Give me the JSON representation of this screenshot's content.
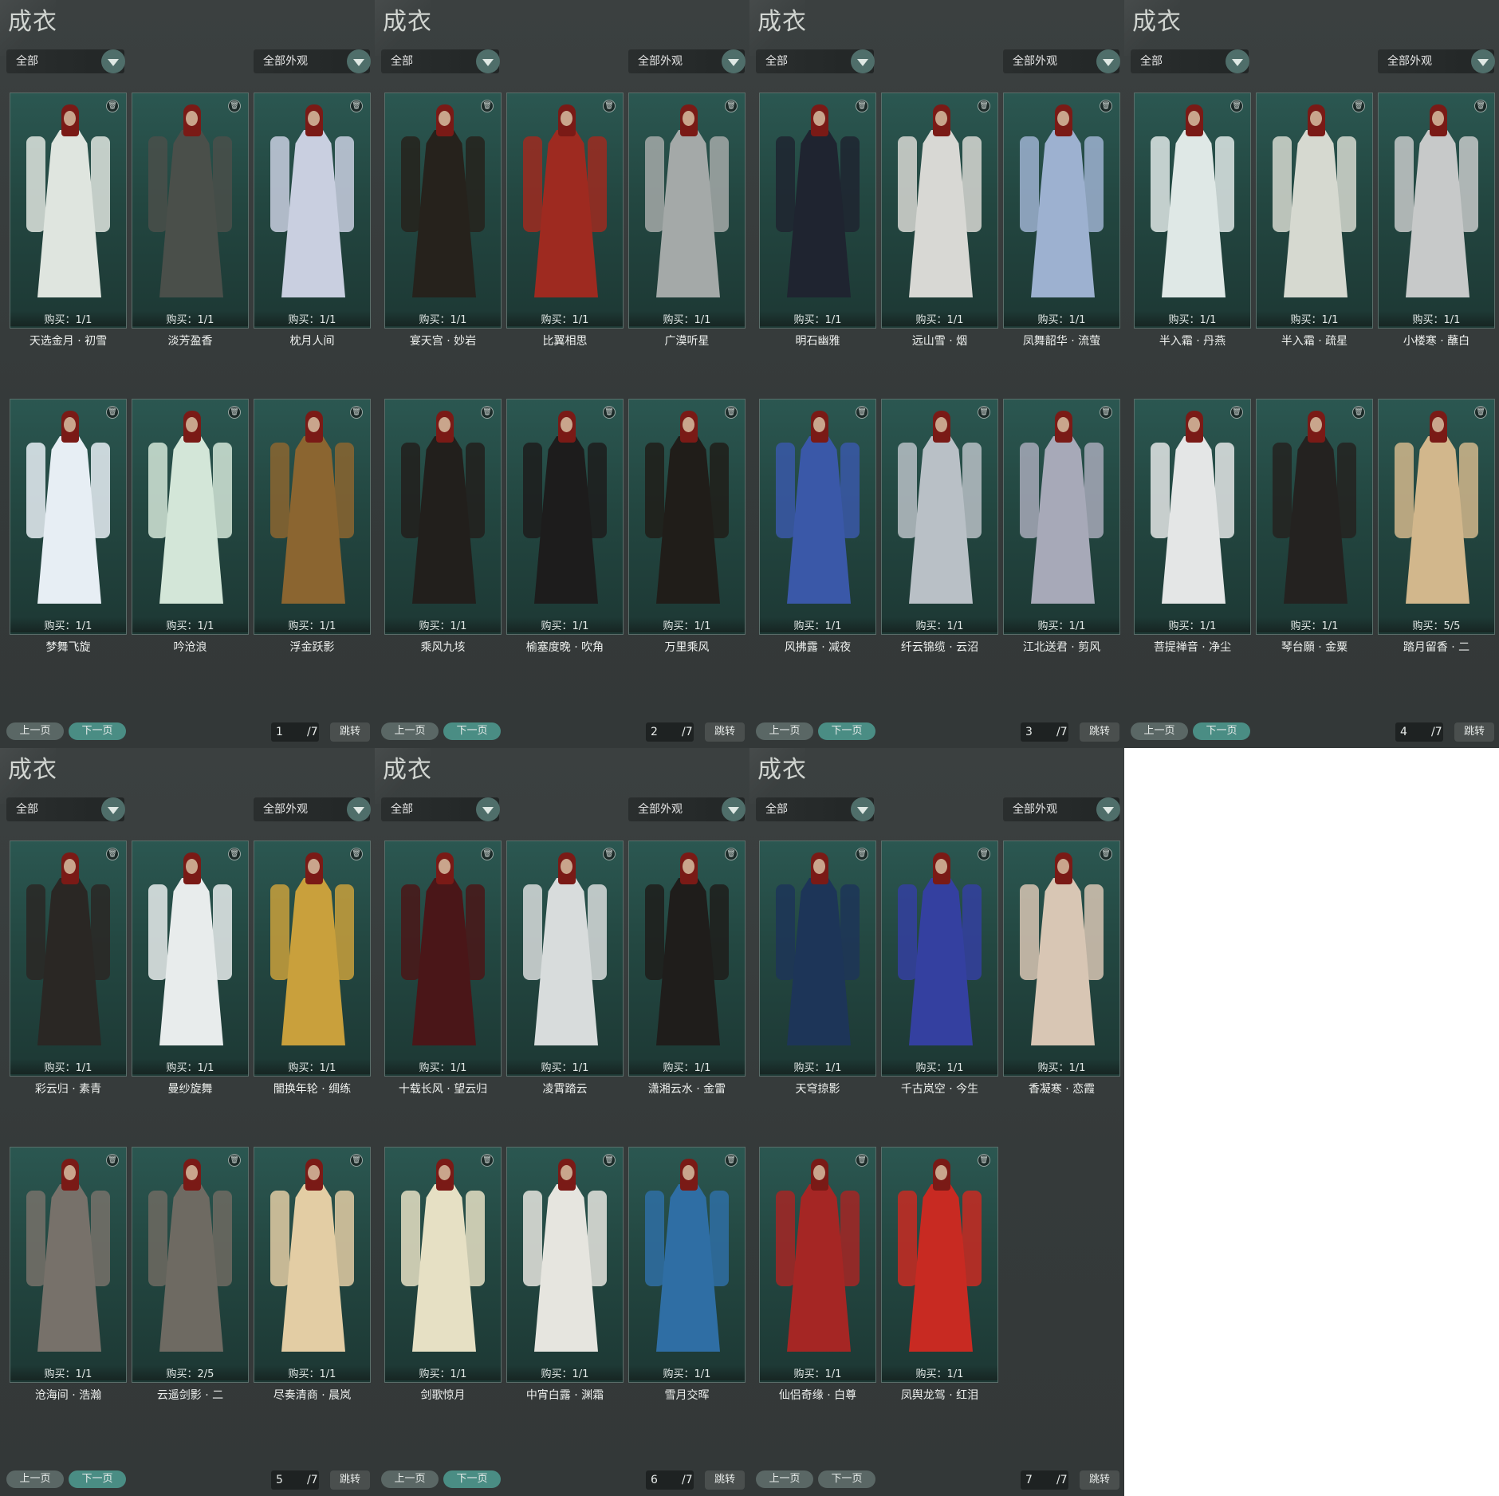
{
  "title": "成衣",
  "filter_left": "全部",
  "filter_right": "全部外观",
  "prev_label": "上一页",
  "next_label": "下一页",
  "jump_label": "跳转",
  "page_total": "/7",
  "trash_icon": "trash-icon",
  "panels": [
    {
      "page": "1",
      "items": [
        {
          "buy": "购买：1/1",
          "name": "天选金月 · 初雪",
          "color": "#dfe5df"
        },
        {
          "buy": "购买：1/1",
          "name": "淡芳盈香",
          "color": "#4a4f4a"
        },
        {
          "buy": "购买：1/1",
          "name": "枕月人间",
          "color": "#c9cfe0"
        },
        {
          "buy": "购买：1/1",
          "name": "梦舞飞旋",
          "color": "#e7eef4"
        },
        {
          "buy": "购买：1/1",
          "name": "吟沧浪",
          "color": "#d3e6d8"
        },
        {
          "buy": "购买：1/1",
          "name": "浮金跃影",
          "color": "#8b6530"
        }
      ]
    },
    {
      "page": "2",
      "items": [
        {
          "buy": "购买：1/1",
          "name": "宴天宫 · 妙岩",
          "color": "#26221c"
        },
        {
          "buy": "购买：1/1",
          "name": "比翼相思",
          "color": "#9e2a20"
        },
        {
          "buy": "购买：1/1",
          "name": "广漠听星",
          "color": "#a4a9a8"
        },
        {
          "buy": "购买：1/1",
          "name": "乘风九垓",
          "color": "#221f1c"
        },
        {
          "buy": "购买：1/1",
          "name": "榆塞度晚 · 吹角",
          "color": "#1d1c1c"
        },
        {
          "buy": "购买：1/1",
          "name": "万里乘风",
          "color": "#201d19"
        }
      ]
    },
    {
      "page": "3",
      "items": [
        {
          "buy": "购买：1/1",
          "name": "明石幽雅",
          "color": "#1f2430"
        },
        {
          "buy": "购买：1/1",
          "name": "远山雪 · 烟",
          "color": "#d8d8d4"
        },
        {
          "buy": "购买：1/1",
          "name": "凤舞韶华 · 流萤",
          "color": "#9db1d0"
        },
        {
          "buy": "购买：1/1",
          "name": "风拂露 · 减夜",
          "color": "#3a58a8"
        },
        {
          "buy": "购买：1/1",
          "name": "纤云锦缆 · 云沼",
          "color": "#b9c0c6"
        },
        {
          "buy": "购买：1/1",
          "name": "江北送君 · 剪风",
          "color": "#a7a9b8"
        }
      ]
    },
    {
      "page": "4",
      "items": [
        {
          "buy": "购买：1/1",
          "name": "半入霜 · 丹燕",
          "color": "#dfe8e6"
        },
        {
          "buy": "购买：1/1",
          "name": "半入霜 · 疏星",
          "color": "#d6d9d0"
        },
        {
          "buy": "购买：1/1",
          "name": "小楼寒 · 蘸白",
          "color": "#c7c9c9"
        },
        {
          "buy": "购买：1/1",
          "name": "菩提禅音 · 净尘",
          "color": "#e4e6e6"
        },
        {
          "buy": "购买：1/1",
          "name": "琴台願 · 金粟",
          "color": "#242220"
        },
        {
          "buy": "购买：5/5",
          "name": "踏月留香 · 二",
          "color": "#d2b78c"
        }
      ]
    },
    {
      "page": "5",
      "items": [
        {
          "buy": "购买：1/1",
          "name": "彩云归 · 素青",
          "color": "#2a2724"
        },
        {
          "buy": "购买：1/1",
          "name": "曼纱旋舞",
          "color": "#e8ecec"
        },
        {
          "buy": "购买：1/1",
          "name": "闇换年轮 · 绸练",
          "color": "#c9a03c"
        },
        {
          "buy": "购买：1/1",
          "name": "沧海间 · 浩瀚",
          "color": "#77716a"
        },
        {
          "buy": "购买：2/5",
          "name": "云遥剑影 · 二",
          "color": "#6e6a62"
        },
        {
          "buy": "购买：1/1",
          "name": "尽奏清商 · 晨岚",
          "color": "#e3cda4"
        }
      ]
    },
    {
      "page": "6",
      "items": [
        {
          "buy": "购买：1/1",
          "name": "十载长风 · 望云归",
          "color": "#4a1618"
        },
        {
          "buy": "购买：1/1",
          "name": "凌霄踏云",
          "color": "#d8dcdc"
        },
        {
          "buy": "购买：1/1",
          "name": "潇湘云水 · 金雷",
          "color": "#1f1d1b"
        },
        {
          "buy": "购买：1/1",
          "name": "剑歌惊月",
          "color": "#e6e0c4"
        },
        {
          "buy": "购买：1/1",
          "name": "中宵白露 · 渊霜",
          "color": "#e6e5df"
        },
        {
          "buy": "购买：1/1",
          "name": "雪月交晖",
          "color": "#2f6ea4"
        }
      ]
    },
    {
      "page": "7",
      "items": [
        {
          "buy": "购买：1/1",
          "name": "天穹掠影",
          "color": "#1d3558"
        },
        {
          "buy": "购买：1/1",
          "name": "千古岚空 · 今生",
          "color": "#3440a0"
        },
        {
          "buy": "购买：1/1",
          "name": "香凝寒 · 恋霞",
          "color": "#d8c6b4"
        },
        {
          "buy": "购买：1/1",
          "name": "仙侣奇缘 · 白尊",
          "color": "#a52624"
        },
        {
          "buy": "购买：1/1",
          "name": "凤舆龙驾 · 红泪",
          "color": "#c82a22"
        }
      ]
    }
  ]
}
